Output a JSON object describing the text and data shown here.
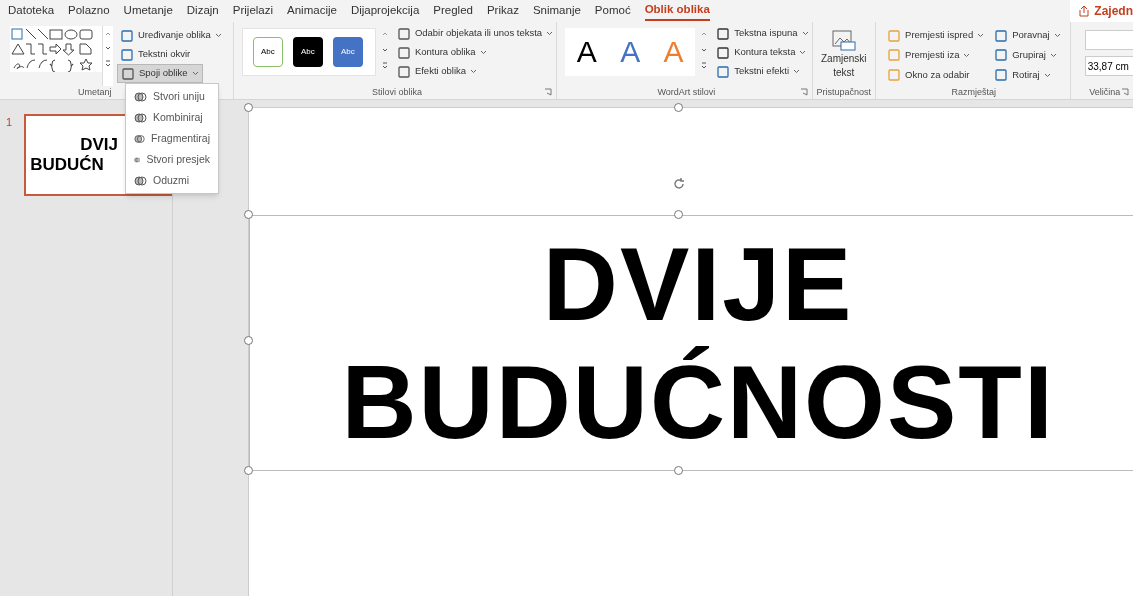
{
  "menu_tabs": [
    {
      "label": "Datoteka",
      "selected": false
    },
    {
      "label": "Polazno",
      "selected": false
    },
    {
      "label": "Umetanje",
      "selected": false
    },
    {
      "label": "Dizajn",
      "selected": false
    },
    {
      "label": "Prijelazi",
      "selected": false
    },
    {
      "label": "Animacije",
      "selected": false
    },
    {
      "label": "Dijaprojekcija",
      "selected": false
    },
    {
      "label": "Pregled",
      "selected": false
    },
    {
      "label": "Prikaz",
      "selected": false
    },
    {
      "label": "Snimanje",
      "selected": false
    },
    {
      "label": "Pomoć",
      "selected": false
    },
    {
      "label": "Oblik oblika",
      "selected": true
    }
  ],
  "share_button": "Zajedn",
  "insert_group": {
    "label": "Umetanj",
    "buttons": [
      {
        "label": "Uređivanje oblika",
        "pressed": false
      },
      {
        "label": "Tekstni okvir",
        "pressed": false
      },
      {
        "label": "Spoji oblike",
        "pressed": true
      }
    ]
  },
  "styles_group": {
    "label": "Stilovi oblika",
    "swatches": [
      {
        "label": "Abc",
        "color": "#ffffff"
      },
      {
        "label": "Abc",
        "color": "#000000"
      },
      {
        "label": "Abc",
        "color": "#4472c4"
      }
    ],
    "buttons": [
      "Odabir objekata ili unos teksta",
      "Kontura oblika",
      "Efekti oblika"
    ]
  },
  "wordart_group": {
    "label": "WordArt stilovi",
    "samples": [
      {
        "label": "A",
        "color": "#000000"
      },
      {
        "label": "A",
        "color": "#4472c4"
      },
      {
        "label": "A",
        "color": "#ed7d31"
      }
    ],
    "buttons": [
      "Tekstna ispuna",
      "Kontura teksta",
      "Tekstni efekti"
    ]
  },
  "accessibility_group": {
    "label": "Pristupačnost",
    "button": "Zamjenski tekst"
  },
  "arrange_group": {
    "label": "Razmještaj",
    "buttons": [
      "Premjesti ispred",
      "Premjesti iza",
      "Okno za odabir",
      "Poravnaj",
      "Grupiraj",
      "Rotiraj"
    ]
  },
  "size_group": {
    "label": "Veličina",
    "width": "33,87 cm"
  },
  "merge_menu": [
    {
      "label": "Stvori uniju"
    },
    {
      "label": "Kombiniraj"
    },
    {
      "label": "Fragmentiraj"
    },
    {
      "label": "Stvori presjek"
    },
    {
      "label": "Oduzmi"
    }
  ],
  "thumbnail": {
    "number": "1",
    "lines": [
      "DVIJ",
      "BUDUĆN"
    ]
  },
  "slide": {
    "lines": [
      "DVIJE",
      "BUDUĆNOSTI"
    ]
  }
}
